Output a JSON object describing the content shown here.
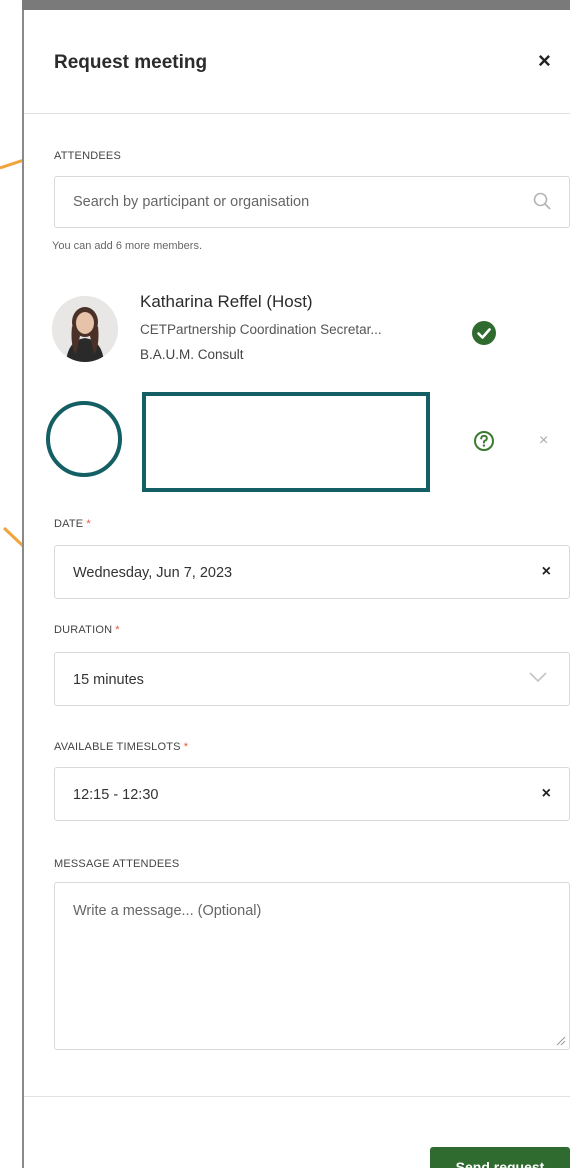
{
  "dialog": {
    "title": "Request meeting",
    "close_icon": "close-icon"
  },
  "attendees": {
    "label": "ATTENDEES",
    "search_placeholder": "Search by participant or organisation",
    "hint": "You can add 6 more members.",
    "host": {
      "name": "Katharina Reffel  (Host)",
      "organisation": "CETPartnership Coordination Secretar...",
      "company": "B.A.U.M. Consult",
      "status_icon": "check-circle-icon"
    },
    "second_attendee": {
      "status_icon": "question-circle-icon",
      "remove_label": "×"
    }
  },
  "date": {
    "label": "DATE",
    "required_mark": "*",
    "value": "Wednesday, Jun 7, 2023",
    "clear_label": "×"
  },
  "duration": {
    "label": "DURATION",
    "required_mark": "*",
    "value": "15 minutes"
  },
  "timeslots": {
    "label": "AVAILABLE TIMESLOTS",
    "required_mark": "*",
    "value": "12:15 - 12:30",
    "clear_label": "×"
  },
  "message": {
    "label": "MESSAGE ATTENDEES",
    "placeholder": "Write a message... (Optional)"
  },
  "footer": {
    "send_label": "Send request"
  },
  "colors": {
    "accent_green": "#2f6b2f",
    "annotation_teal": "#135f64",
    "annotation_arrow": "#f2a33a",
    "required_red": "#e8553f"
  }
}
